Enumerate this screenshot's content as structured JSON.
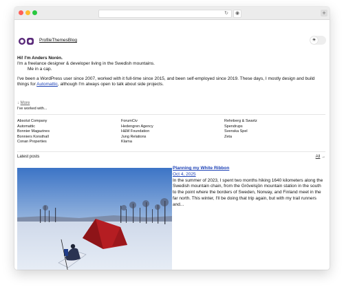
{
  "browser": {
    "controls": [
      "close",
      "minimize",
      "zoom"
    ],
    "reload_icon": "reload-icon",
    "extension_icon": "extension-icon",
    "new_tab_icon": "plus-icon"
  },
  "header": {
    "logo": "logo-icon",
    "nav": [
      "Profile",
      "Themes",
      "Blog"
    ],
    "theme_toggle_icon": "sun-icon"
  },
  "intro": {
    "heading": "Hi! I'm Anders Norén.",
    "line1": "I'm a freelance designer & developer living in the Swedish mountains.",
    "line2": "Me in a cap.",
    "para_before": "I've been a WordPress user since 2007, worked with it full-time since 2015, and been self-employed since 2019. These days, I mostly design and build things for ",
    "link": "Automattic",
    "para_after": ", although I'm always open to talk about side projects.",
    "more": "More",
    "worked_with": "I've worked with..."
  },
  "clients": {
    "col1": [
      "Absolut Company",
      "Automattic",
      "Bonnier Magazines",
      "Bonniers Konsthall",
      "Conan Properties"
    ],
    "col2": [
      "ForumCiv",
      "Hedengren Agency",
      "H&M Foundation",
      "Jung Relations",
      "Klarna"
    ],
    "col3": [
      "Rehnberg & Swartz",
      "Spendrups",
      "Svenska Spel",
      "Zeta"
    ]
  },
  "latest": {
    "title": "Latest posts",
    "all": "All",
    "arrow": "→"
  },
  "post": {
    "title": "Planning my White Ribbon",
    "date": "Oct 4, 2025",
    "excerpt": "In the summer of 2023, I spent two months hiking 1640 kilometers along the Swedish mountain chain, from the Grövelsjön mountain station in the south to the point where the borders of Sweden, Norway, and Finland meet in the far north. This winter, I'll be doing that trip again, but with my trail runners and..."
  }
}
